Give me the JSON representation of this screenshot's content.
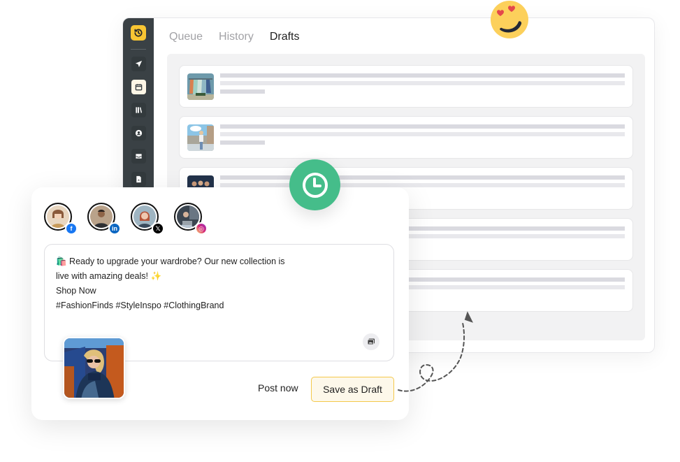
{
  "app": {
    "tabs": [
      {
        "label": "Queue",
        "active": false
      },
      {
        "label": "History",
        "active": false
      },
      {
        "label": "Drafts",
        "active": true
      }
    ],
    "sidebar": {
      "logo_icon": "clock-history-icon",
      "items": [
        {
          "icon": "send-icon",
          "active": false
        },
        {
          "icon": "calendar-icon",
          "active": true
        },
        {
          "icon": "library-icon",
          "active": false
        },
        {
          "icon": "user-circle-icon",
          "active": false
        },
        {
          "icon": "inbox-icon",
          "active": false
        },
        {
          "icon": "document-icon",
          "active": false
        }
      ]
    },
    "drafts": [
      {
        "thumbnail": "clothing-rack"
      },
      {
        "thumbnail": "woman-at-palace"
      },
      {
        "thumbnail": "group-of-three"
      },
      {
        "thumbnail": ""
      },
      {
        "thumbnail": ""
      }
    ]
  },
  "composer": {
    "accounts": [
      {
        "network": "facebook",
        "badge": "f",
        "color": "#1877f2"
      },
      {
        "network": "linkedin",
        "badge": "in",
        "color": "#0a66c2"
      },
      {
        "network": "x",
        "badge": "𝕏",
        "color": "#000000"
      },
      {
        "network": "instagram",
        "badge": "◎",
        "color": "#d62976"
      }
    ],
    "post_lines": [
      "🛍️ Ready to upgrade your wardrobe? Our new collection is",
      "live with amazing deals! ✨",
      "Shop Now",
      "#FashionFinds #StyleInspo #ClothingBrand"
    ],
    "post_now_label": "Post now",
    "save_draft_label": "Save as Draft"
  },
  "colors": {
    "accent": "#f9c633",
    "clock_badge": "#45bd8a",
    "sidebar_bg": "#3a4145"
  }
}
